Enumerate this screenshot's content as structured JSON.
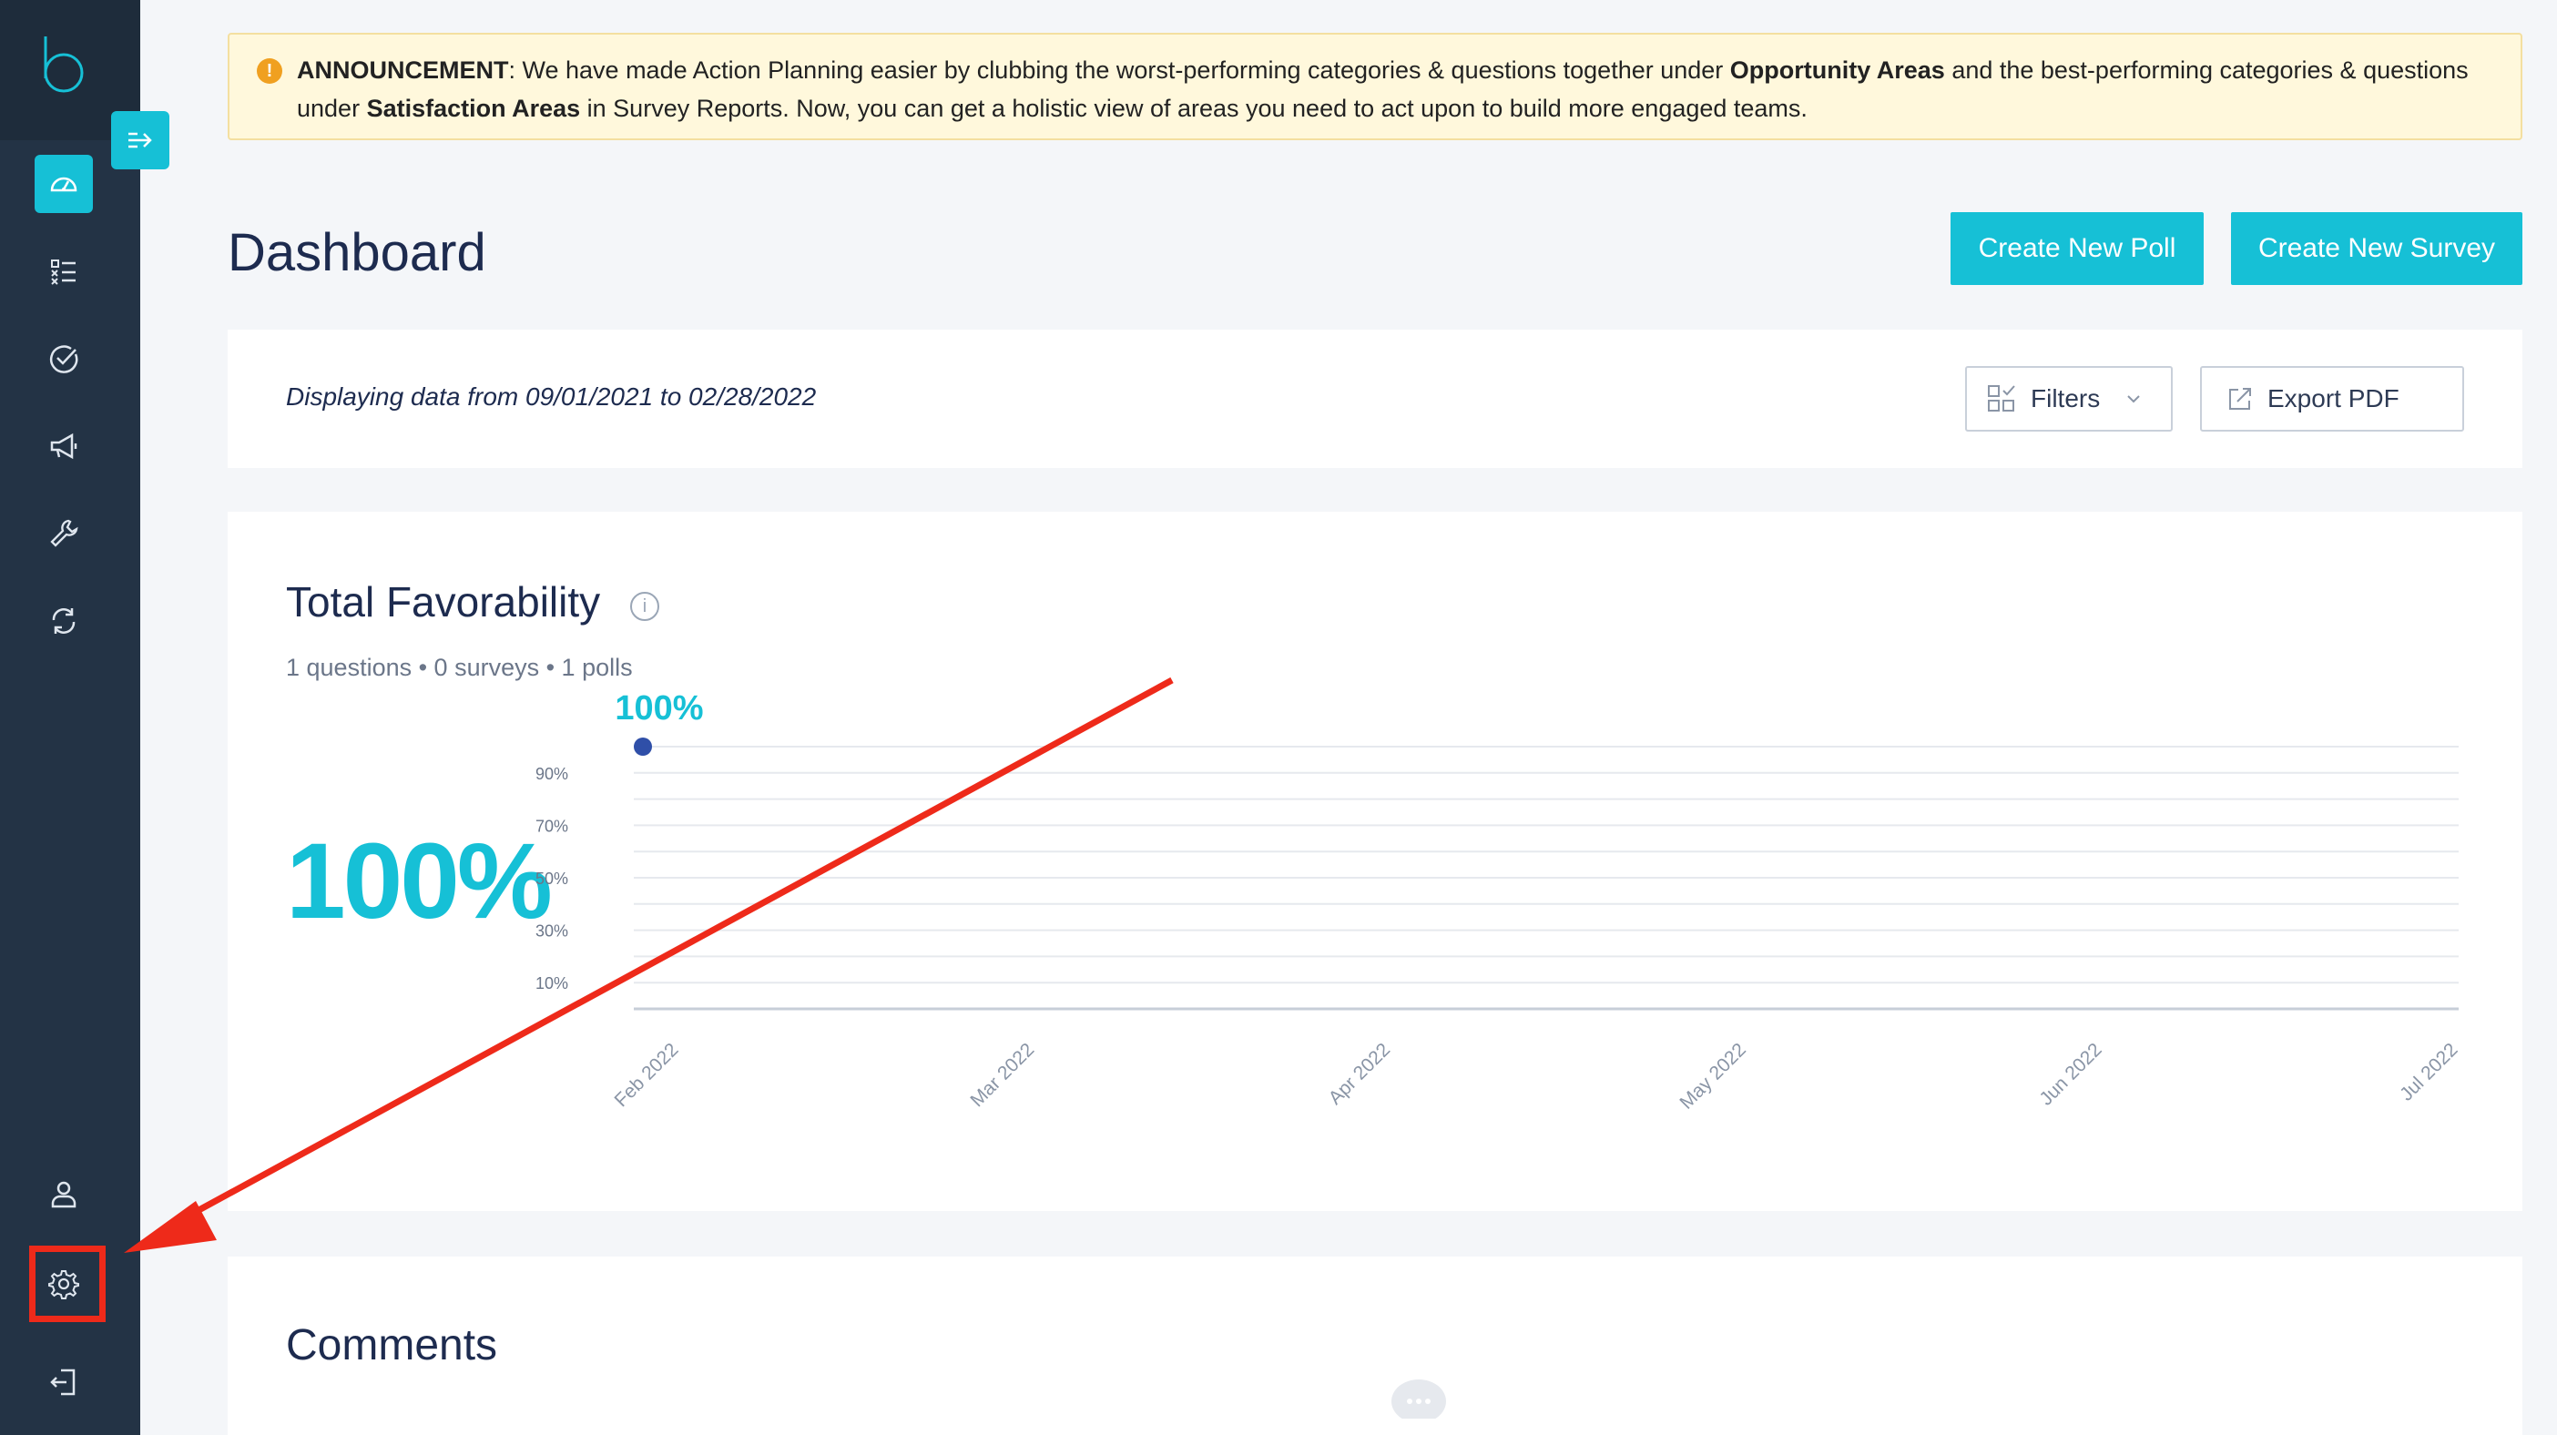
{
  "announcement": {
    "label": "ANNOUNCEMENT",
    "text1": ": We have made Action Planning easier by clubbing the worst-performing categories & questions  together under ",
    "bold1": "Opportunity Areas",
    "text2": " and the best-performing  categories & questions under ",
    "bold2": "Satisfaction Areas",
    "text3": " in Survey Reports.  Now, you can get a holistic view of areas you need to act upon to build more engaged teams."
  },
  "header": {
    "title": "Dashboard",
    "create_poll": "Create New Poll",
    "create_survey": "Create New Survey"
  },
  "filter_bar": {
    "date_range": "Displaying data from 09/01/2021 to 02/28/2022",
    "filters": "Filters",
    "export": "Export PDF"
  },
  "favorability": {
    "title": "Total Favorability",
    "subtitle": "1 questions • 0 surveys • 1 polls",
    "big_value": "100%"
  },
  "chart_data": {
    "type": "line",
    "x_ticks": [
      "Feb 2022",
      "Mar 2022",
      "Apr 2022",
      "May 2022",
      "Jun 2022",
      "Jul 2022"
    ],
    "y_ticks": [
      "10%",
      "30%",
      "50%",
      "70%",
      "90%"
    ],
    "series": [
      {
        "x": [
          "Feb 2022"
        ],
        "values": [
          100
        ]
      }
    ],
    "data_labels": [
      "100%"
    ],
    "ylim": [
      0,
      100
    ],
    "grid": true,
    "colors": {
      "point": "#2f4fa8",
      "label": "#16c0d6",
      "grid": "#e6e9ee",
      "axis": "#c7ced8"
    }
  },
  "comments": {
    "title": "Comments"
  },
  "sidebar": {
    "icons": [
      "dashboard-icon",
      "checklist-icon",
      "check-circle-icon",
      "megaphone-icon",
      "wrench-icon",
      "refresh-icon",
      "user-icon",
      "gear-icon",
      "logout-icon"
    ]
  },
  "colors": {
    "accent": "#16c0d6",
    "sidebar": "#233345",
    "annotation": "#ee2a1a"
  }
}
